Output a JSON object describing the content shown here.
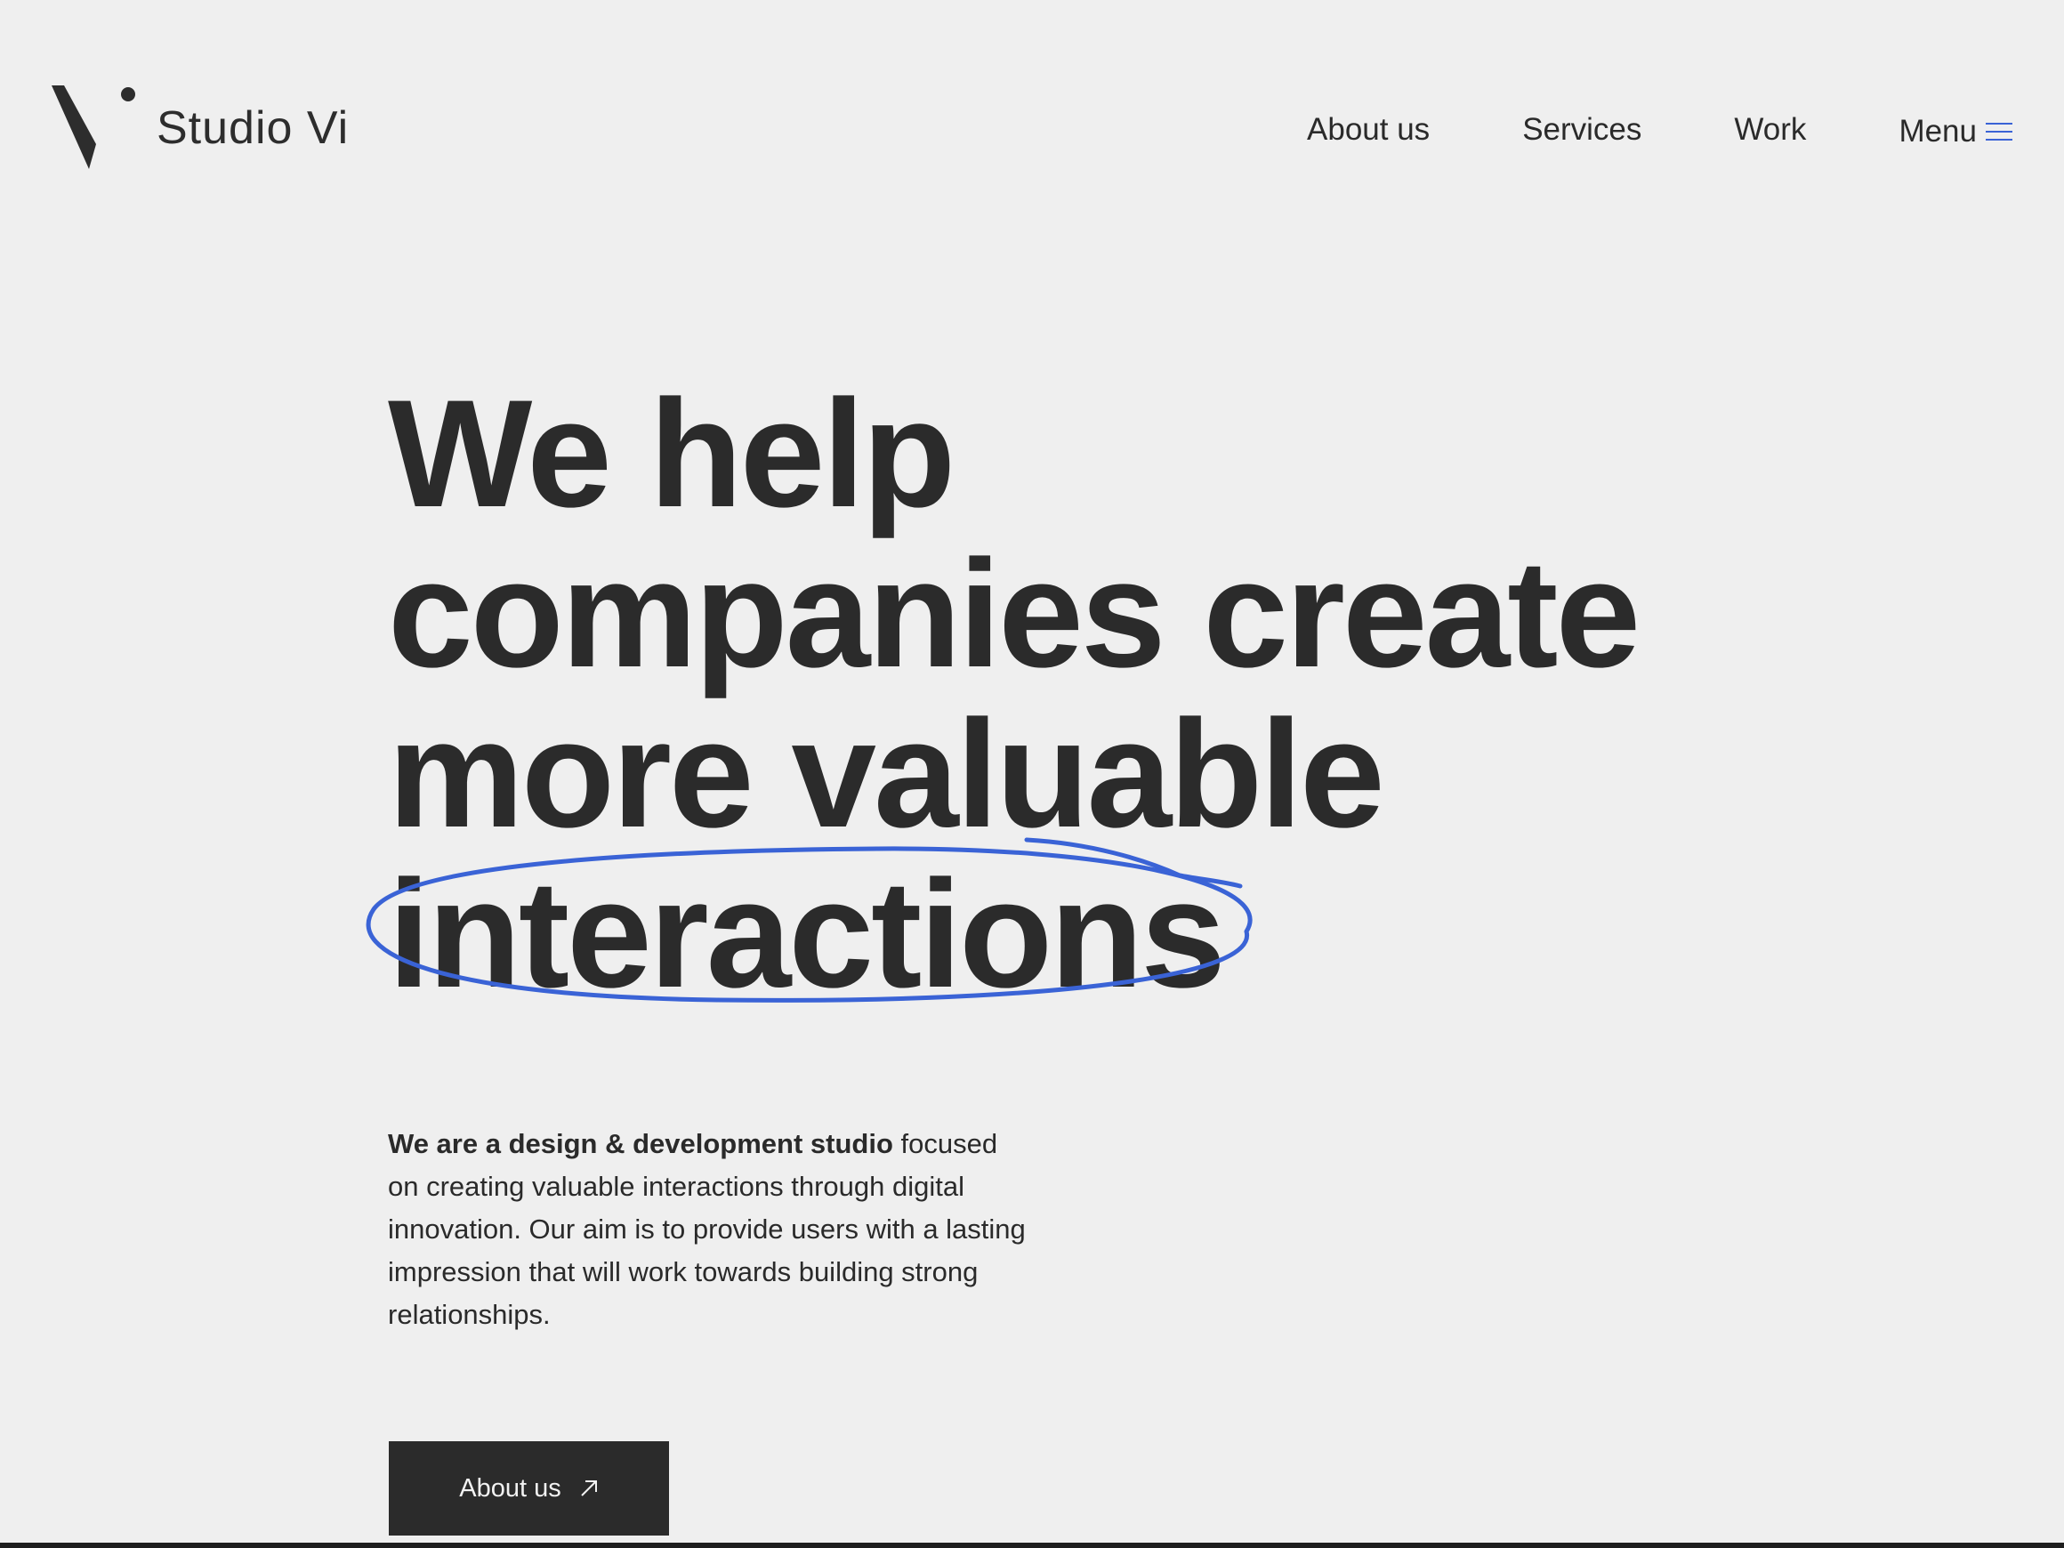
{
  "brand": {
    "name": "Studio Vi",
    "accent_color": "#3a63d6",
    "logo_icon": "studio-vi-logo-mark"
  },
  "nav": {
    "items": [
      {
        "label": "About us"
      },
      {
        "label": "Services"
      },
      {
        "label": "Work"
      }
    ],
    "menu_label": "Menu",
    "menu_icon": "hamburger-icon"
  },
  "hero": {
    "headline_lines": [
      "We help",
      "companies create",
      "more valuable",
      "interactions"
    ],
    "intro_bold": "We are a design & development studio",
    "intro_rest": " focused on creating valuable interactions through digital innovation. Our aim is to provide users with a lasting impression that will work towards building strong relationships.",
    "cta_label": "About us",
    "cta_icon": "arrow-up-right-icon"
  }
}
